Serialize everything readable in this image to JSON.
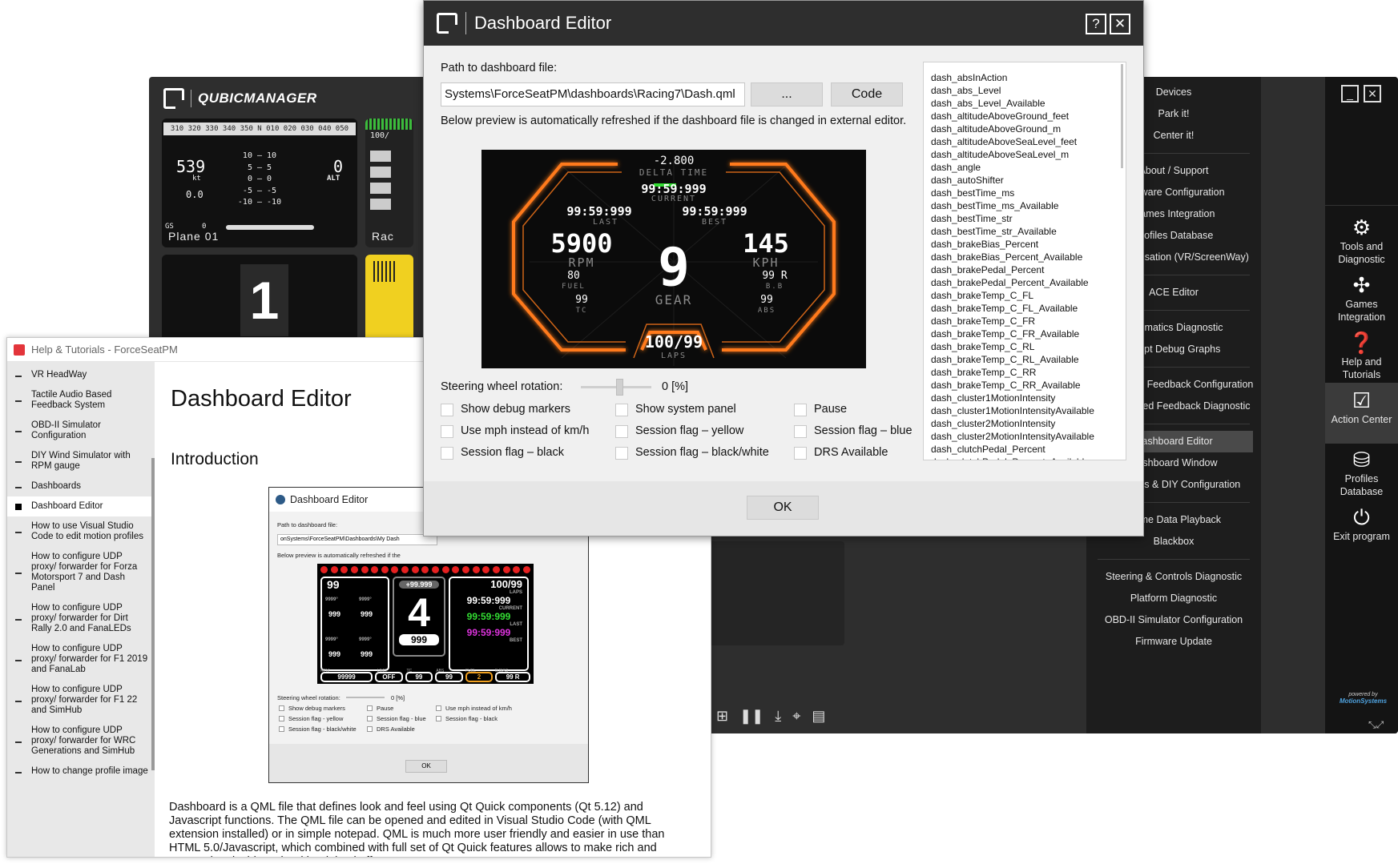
{
  "qm": {
    "brand": "QUBICMANAGER",
    "tiles": {
      "plane": {
        "compass": "310 320 330 340 350 N 010 020 030 040 050",
        "speed": "539",
        "speed_unit": "kt",
        "alt": "0",
        "alt_unit": "ALT",
        "left_small": "0.0",
        "pitch": [
          "10 — 10",
          "5 — 5",
          "0 — 0",
          "-5 — -5",
          "-10 — -10"
        ],
        "gs": "GS",
        "gs_val": "0",
        "caption": "Plane 01"
      },
      "race_caption": "Rac",
      "race_top": "100/",
      "gear_big": "1"
    },
    "toolbar_icons": [
      "grid-icon",
      "pause-icon",
      "download-icon",
      "focus-icon",
      "terminal-icon"
    ],
    "menu": [
      [
        "Devices",
        "Park it!",
        "Center it!"
      ],
      [
        "About / Support",
        "Software Configuration",
        "Games Integration",
        "Profiles Database",
        "n Compensation (VR/ScreenWay)"
      ],
      [
        "ACE Editor"
      ],
      [
        "Kinematics Diagnostic",
        "Script Debug Graphs"
      ],
      [
        "udio Based Feedback Configuration",
        "Audio Based Feedback Diagnostic"
      ],
      [
        "Dashboard Editor",
        "Dashboard Window",
        "cessories & DIY Configuration"
      ],
      [
        "Game Data Playback",
        "Blackbox"
      ],
      [
        "Steering & Controls Diagnostic",
        "Platform Diagnostic",
        "OBD-II Simulator Configuration",
        "Firmware Update"
      ]
    ],
    "active_menu_item": "Dashboard Editor",
    "side_buttons": [
      {
        "label": "Tools and Diagnostic",
        "icon": "gears-icon"
      },
      {
        "label": "Games Integration",
        "icon": "games-icon"
      },
      {
        "label": "Help and Tutorials",
        "icon": "help-icon"
      },
      {
        "label": "Action Center",
        "icon": "checkbox-icon"
      },
      {
        "label": "Profiles Database",
        "icon": "database-icon"
      },
      {
        "label": "Exit program",
        "icon": "power-icon"
      }
    ],
    "powered_by": "powered by",
    "powered_brand": "MotionSystems"
  },
  "help": {
    "window_title": "Help & Tutorials - ForceSeatPM",
    "nav": [
      "VR HeadWay",
      "Tactile Audio Based Feedback System",
      "OBD-II Simulator Configuration",
      "DIY Wind Simulator with RPM gauge",
      "Dashboards",
      "Dashboard Editor",
      "How to use Visual Studio Code to edit motion profiles",
      "How to configure UDP proxy/ forwarder for Forza Motorsport 7 and Dash Panel",
      "How to configure UDP proxy/ forwarder for Dirt Rally 2.0 and FanaLEDs",
      "How to configure UDP proxy/ forwarder for F1 2019 and FanaLab",
      "How to configure UDP proxy/ forwarder for F1 22 and SimHub",
      "How to configure UDP proxy/ forwarder for WRC Generations and SimHub",
      "How to change profile image"
    ],
    "active_nav": "Dashboard Editor",
    "h1": "Dashboard Editor",
    "h2": "Introduction",
    "paragraph": "Dashboard is a QML file that defines look and feel using Qt Quick components (Qt 5.12) and Javascript functions. The QML file can be opened and edited in Visual Studio Code (with QML extension installed) or in simple notepad. QML is much more user friendly and easier in use than HTML 5.0/Javascript, which combined with full set of Qt Quick features allows to make rich and responsive dashboards with minimal effort.",
    "mini": {
      "title": "Dashboard Editor",
      "path_label": "Path to dashboard file:",
      "path_value": "onSystems\\ForceSeatPM\\Dashboards\\My Dash",
      "refresh_note": "Below preview is automatically refreshed if the",
      "speed": "99",
      "delta": "+99.999",
      "gear": "4",
      "kmh": "999",
      "laps": "100/99",
      "laps_lbl": "LAPS",
      "current": "99:59:999",
      "current_lbl": "CURRENT",
      "last": "99:59:999",
      "last_lbl": "LAST",
      "best": "99:59:999",
      "best_lbl": "BEST",
      "tyre_vals": [
        "999",
        "999",
        "999",
        "999"
      ],
      "tyre_temps": [
        "9999°",
        "9999°",
        "9999°",
        "9999°"
      ],
      "bottom": [
        "99999",
        "OFF",
        "99",
        "99",
        "2",
        "99 R"
      ],
      "bottom_lbls": [
        "RPM",
        "LIMIT",
        "TC",
        "ABS",
        "FUEL",
        "B.BIAS"
      ],
      "steering_label": "Steering wheel rotation:",
      "steering_value": "0 [%]",
      "checks": [
        "Show debug markers",
        "Pause",
        "Use mph instead of km/h",
        "Session flag - yellow",
        "Session flag - blue",
        "Session flag - black",
        "Session flag - black/white",
        "DRS Available"
      ],
      "ok": "OK"
    }
  },
  "editor": {
    "title": "Dashboard Editor",
    "help_btn": "?",
    "close_btn": "✕",
    "path_label": "Path to dashboard file:",
    "path_value": "Systems\\ForceSeatPM\\dashboards\\Racing7\\Dash.qml",
    "browse": "...",
    "code": "Code",
    "note": "Below preview is automatically refreshed if the dashboard file is changed in external editor.",
    "steering_label": "Steering wheel rotation:",
    "steering_value": "0 [%]",
    "steering_level": 0.5,
    "checkboxes": [
      "Show debug markers",
      "Show system panel",
      "Pause",
      "Use mph instead of km/h",
      "Session flag – yellow",
      "Session flag – blue",
      "Session flag – black",
      "Session flag – black/white",
      "DRS Available"
    ],
    "ok": "OK",
    "variables": [
      "dash_absInAction",
      "dash_abs_Level",
      "dash_abs_Level_Available",
      "dash_altitudeAboveGround_feet",
      "dash_altitudeAboveGround_m",
      "dash_altitudeAboveSeaLevel_feet",
      "dash_altitudeAboveSeaLevel_m",
      "dash_angle",
      "dash_autoShifter",
      "dash_bestTime_ms",
      "dash_bestTime_ms_Available",
      "dash_bestTime_str",
      "dash_bestTime_str_Available",
      "dash_brakeBias_Percent",
      "dash_brakeBias_Percent_Available",
      "dash_brakePedal_Percent",
      "dash_brakePedal_Percent_Available",
      "dash_brakeTemp_C_FL",
      "dash_brakeTemp_C_FL_Available",
      "dash_brakeTemp_C_FR",
      "dash_brakeTemp_C_FR_Available",
      "dash_brakeTemp_C_RL",
      "dash_brakeTemp_C_RL_Available",
      "dash_brakeTemp_C_RR",
      "dash_brakeTemp_C_RR_Available",
      "dash_cluster1MotionIntensity",
      "dash_cluster1MotionIntensityAvailable",
      "dash_cluster2MotionIntensity",
      "dash_cluster2MotionIntensityAvailable",
      "dash_clutchPedal_Percent",
      "dash_clutchPedal_Percent_Available"
    ],
    "dash": {
      "delta": "-2.800",
      "delta_lbl": "DELTA TIME",
      "current": "99:59:999",
      "current_lbl": "CURRENT",
      "last": "99:59:999",
      "last_lbl": "LAST",
      "best": "99:59:999",
      "best_lbl": "BEST",
      "rpm": "5900",
      "rpm_lbl": "RPM",
      "speed": "145",
      "speed_lbl": "KPH",
      "gear": "9",
      "gear_lbl": "GEAR",
      "fuel": "80",
      "fuel_lbl": "FUEL",
      "tc": "99",
      "tc_lbl": "TC",
      "bb": "99 R",
      "bb_lbl": "B.B",
      "abs": "99",
      "abs_lbl": "ABS",
      "laps": "100/99",
      "laps_lbl": "LAPS",
      "accent": "#ff7a1a"
    }
  }
}
